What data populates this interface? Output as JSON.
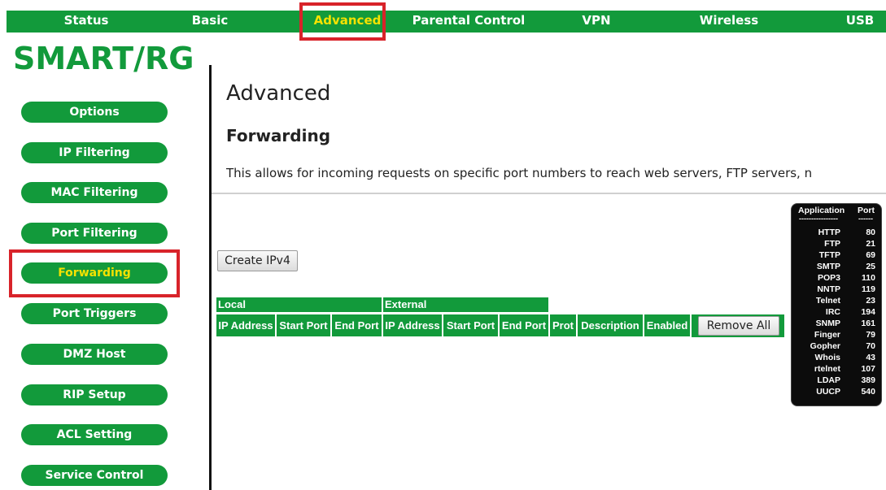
{
  "nav": {
    "items": [
      {
        "label": "Status"
      },
      {
        "label": "Basic"
      },
      {
        "label": "Advanced"
      },
      {
        "label": "Parental Control"
      },
      {
        "label": "VPN"
      },
      {
        "label": "Wireless"
      },
      {
        "label": "USB"
      }
    ],
    "active": "Advanced"
  },
  "logo": {
    "text": "SMART/RG"
  },
  "sidebar": {
    "items": [
      {
        "label": "Options"
      },
      {
        "label": "IP Filtering"
      },
      {
        "label": "MAC Filtering"
      },
      {
        "label": "Port Filtering"
      },
      {
        "label": "Forwarding"
      },
      {
        "label": "Port Triggers"
      },
      {
        "label": "DMZ Host"
      },
      {
        "label": "RIP Setup"
      },
      {
        "label": "ACL Setting"
      },
      {
        "label": "Service Control"
      }
    ],
    "active": "Forwarding"
  },
  "main": {
    "title": "Advanced",
    "section": "Forwarding",
    "description": "This allows for incoming requests on specific port numbers to reach web servers, FTP servers, n",
    "create_button": "Create IPv4",
    "table": {
      "groups": [
        "Local",
        "External"
      ],
      "columns": [
        "IP Address",
        "Start Port",
        "End Port",
        "IP Address",
        "Start Port",
        "End Port",
        "Prot",
        "Description",
        "Enabled"
      ],
      "remove_all": "Remove All"
    }
  },
  "ports": {
    "header_app": "Application",
    "header_port": "Port",
    "dash_app": "----------------",
    "dash_port": "------",
    "rows": [
      {
        "app": "HTTP",
        "port": "80"
      },
      {
        "app": "FTP",
        "port": "21"
      },
      {
        "app": "TFTP",
        "port": "69"
      },
      {
        "app": "SMTP",
        "port": "25"
      },
      {
        "app": "POP3",
        "port": "110"
      },
      {
        "app": "NNTP",
        "port": "119"
      },
      {
        "app": "Telnet",
        "port": "23"
      },
      {
        "app": "IRC",
        "port": "194"
      },
      {
        "app": "SNMP",
        "port": "161"
      },
      {
        "app": "Finger",
        "port": "79"
      },
      {
        "app": "Gopher",
        "port": "70"
      },
      {
        "app": "Whois",
        "port": "43"
      },
      {
        "app": "rtelnet",
        "port": "107"
      },
      {
        "app": "LDAP",
        "port": "389"
      },
      {
        "app": "UUCP",
        "port": "540"
      }
    ]
  },
  "colors": {
    "brand_green": "#129a3b",
    "active_yellow": "#f5e200",
    "highlight_red": "#d8232a"
  }
}
